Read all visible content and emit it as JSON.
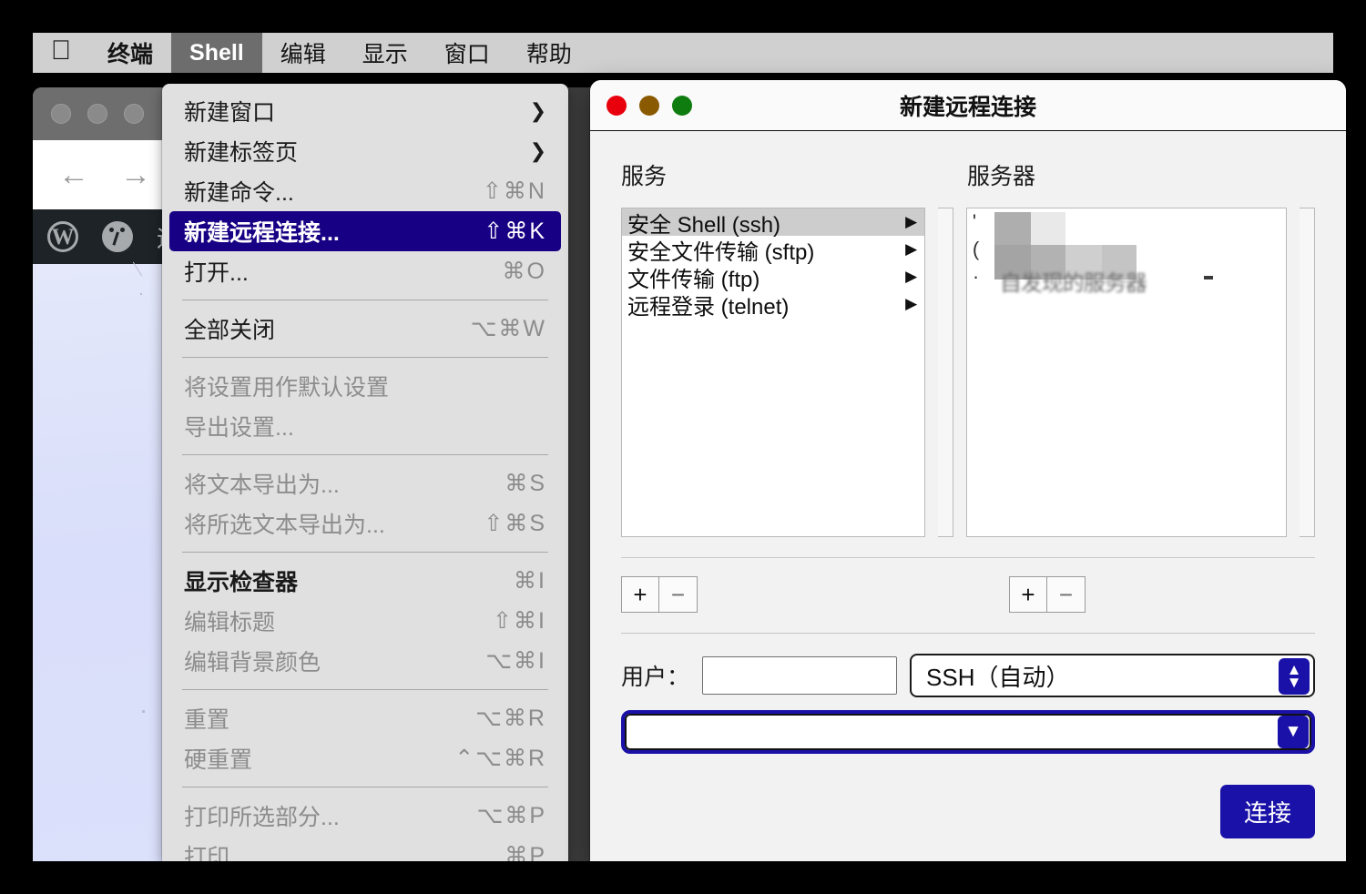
{
  "menubar": {
    "apple_icon": "apple-logo",
    "items": [
      {
        "label": "终端",
        "bold": true,
        "active": false
      },
      {
        "label": "Shell",
        "bold": true,
        "active": true
      },
      {
        "label": "编辑",
        "bold": false,
        "active": false
      },
      {
        "label": "显示",
        "bold": false,
        "active": false
      },
      {
        "label": "窗口",
        "bold": false,
        "active": false
      },
      {
        "label": "帮助",
        "bold": false,
        "active": false
      }
    ]
  },
  "shell_menu": {
    "items": [
      {
        "type": "item",
        "label": "新建窗口",
        "key": "",
        "submenu": true,
        "state": "enabled"
      },
      {
        "type": "item",
        "label": "新建标签页",
        "key": "",
        "submenu": true,
        "state": "enabled"
      },
      {
        "type": "item",
        "label": "新建命令...",
        "key": "⇧⌘N",
        "submenu": false,
        "state": "enabled"
      },
      {
        "type": "item",
        "label": "新建远程连接...",
        "key": "⇧⌘K",
        "submenu": false,
        "state": "selected"
      },
      {
        "type": "item",
        "label": "打开...",
        "key": "⌘O",
        "submenu": false,
        "state": "enabled"
      },
      {
        "type": "sep"
      },
      {
        "type": "item",
        "label": "全部关闭",
        "key": "⌥⌘W",
        "submenu": false,
        "state": "enabled"
      },
      {
        "type": "sep"
      },
      {
        "type": "item",
        "label": "将设置用作默认设置",
        "key": "",
        "submenu": false,
        "state": "disabled"
      },
      {
        "type": "item",
        "label": "导出设置...",
        "key": "",
        "submenu": false,
        "state": "disabled"
      },
      {
        "type": "sep"
      },
      {
        "type": "item",
        "label": "将文本导出为...",
        "key": "⌘S",
        "submenu": false,
        "state": "disabled"
      },
      {
        "type": "item",
        "label": "将所选文本导出为...",
        "key": "⇧⌘S",
        "submenu": false,
        "state": "disabled"
      },
      {
        "type": "sep"
      },
      {
        "type": "item",
        "label": "显示检查器",
        "key": "⌘I",
        "submenu": false,
        "state": "bold"
      },
      {
        "type": "item",
        "label": "编辑标题",
        "key": "⇧⌘I",
        "submenu": false,
        "state": "disabled"
      },
      {
        "type": "item",
        "label": "编辑背景颜色",
        "key": "⌥⌘I",
        "submenu": false,
        "state": "disabled"
      },
      {
        "type": "sep"
      },
      {
        "type": "item",
        "label": "重置",
        "key": "⌥⌘R",
        "submenu": false,
        "state": "disabled"
      },
      {
        "type": "item",
        "label": "硬重置",
        "key": "⌃⌥⌘R",
        "submenu": false,
        "state": "disabled"
      },
      {
        "type": "sep"
      },
      {
        "type": "item",
        "label": "打印所选部分...",
        "key": "⌥⌘P",
        "submenu": false,
        "state": "disabled"
      },
      {
        "type": "item",
        "label": "打印",
        "key": "⌘P",
        "submenu": false,
        "state": "disabled"
      }
    ]
  },
  "dialog": {
    "title": "新建远程连接",
    "traffic_lights": [
      "close-button",
      "minimize-button",
      "zoom-button"
    ],
    "headings": {
      "services": "服务",
      "servers": "服务器"
    },
    "services": [
      {
        "label": "安全 Shell (ssh)",
        "selected": true
      },
      {
        "label": "安全文件传输 (sftp)",
        "selected": false
      },
      {
        "label": "文件传输 (ftp)",
        "selected": false
      },
      {
        "label": "远程登录 (telnet)",
        "selected": false
      }
    ],
    "servers": [
      {
        "label": "",
        "redacted": true
      },
      {
        "label": "",
        "redacted": true
      },
      {
        "label": "自发现的服务器",
        "redacted": true
      }
    ],
    "services_stepper": {
      "add": "+",
      "remove": "−"
    },
    "servers_stepper": {
      "add": "+",
      "remove": "−"
    },
    "user": {
      "label": "用户：",
      "value": "",
      "placeholder": ""
    },
    "ssh_mode": {
      "value": "SSH（自动）"
    },
    "command_combo": {
      "value": "",
      "placeholder": ""
    },
    "connect_button": "连接"
  },
  "background": {
    "browser_close_glyph": "×",
    "back_glyph": "←",
    "forward_glyph": "→",
    "wp_logo": "W",
    "admin_bar_text": "迪哥"
  },
  "colors": {
    "menu_highlight": "#180085",
    "accent_blue": "#1a12a8",
    "menubar_bg": "#d0d0d0",
    "menu_bg": "#e0e0e0",
    "dialog_bg": "#f2f2f2",
    "traffic_red": "#e8000d",
    "traffic_amber": "#8a5a00",
    "traffic_green": "#0f7c0f",
    "wp_adminbar": "#1d2327"
  }
}
